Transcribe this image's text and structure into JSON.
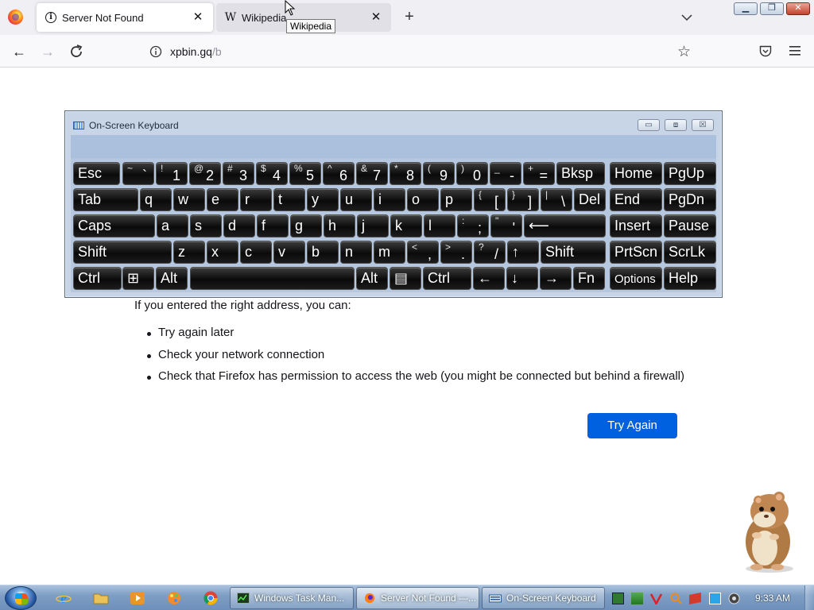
{
  "browser": {
    "tabs": [
      {
        "title": "Server Not Found",
        "active": true
      },
      {
        "title": "Wikipedia",
        "active": false
      }
    ],
    "tooltip": "Wikipedia",
    "url": {
      "host": "xpbin.gq",
      "path": "/b"
    }
  },
  "page": {
    "heading": "If you entered the right address, you can:",
    "suggestions": [
      "Try again later",
      "Check your network connection",
      "Check that Firefox has permission to access the web (you might be connected but behind a firewall)"
    ],
    "try_again_label": "Try Again"
  },
  "osk": {
    "title": "On-Screen Keyboard",
    "rows": [
      [
        {
          "type": "n",
          "label": "Esc"
        },
        {
          "type": "d",
          "top": "~",
          "bot": "`"
        },
        {
          "type": "d",
          "top": "!",
          "bot": "1"
        },
        {
          "type": "d",
          "top": "@",
          "bot": "2"
        },
        {
          "type": "d",
          "top": "#",
          "bot": "3"
        },
        {
          "type": "d",
          "top": "$",
          "bot": "4"
        },
        {
          "type": "d",
          "top": "%",
          "bot": "5"
        },
        {
          "type": "d",
          "top": "^",
          "bot": "6"
        },
        {
          "type": "d",
          "top": "&",
          "bot": "7"
        },
        {
          "type": "d",
          "top": "*",
          "bot": "8"
        },
        {
          "type": "d",
          "top": "(",
          "bot": "9"
        },
        {
          "type": "d",
          "top": ")",
          "bot": "0"
        },
        {
          "type": "d",
          "top": "_",
          "bot": "-"
        },
        {
          "type": "d",
          "top": "+",
          "bot": "="
        },
        {
          "type": "n",
          "label": "Bksp"
        },
        {
          "type": "n",
          "label": "Home"
        },
        {
          "type": "n",
          "label": "PgUp"
        }
      ],
      [
        {
          "type": "n",
          "label": "Tab"
        },
        {
          "type": "n",
          "label": "q"
        },
        {
          "type": "n",
          "label": "w"
        },
        {
          "type": "n",
          "label": "e"
        },
        {
          "type": "n",
          "label": "r"
        },
        {
          "type": "n",
          "label": "t"
        },
        {
          "type": "n",
          "label": "y"
        },
        {
          "type": "n",
          "label": "u"
        },
        {
          "type": "n",
          "label": "i"
        },
        {
          "type": "n",
          "label": "o"
        },
        {
          "type": "n",
          "label": "p"
        },
        {
          "type": "d",
          "top": "{",
          "bot": "["
        },
        {
          "type": "d",
          "top": "}",
          "bot": "]"
        },
        {
          "type": "d",
          "top": "|",
          "bot": "\\"
        },
        {
          "type": "n",
          "label": "Del"
        },
        {
          "type": "n",
          "label": "End"
        },
        {
          "type": "n",
          "label": "PgDn"
        }
      ],
      [
        {
          "type": "n",
          "label": "Caps"
        },
        {
          "type": "n",
          "label": "a"
        },
        {
          "type": "n",
          "label": "s"
        },
        {
          "type": "n",
          "label": "d"
        },
        {
          "type": "n",
          "label": "f"
        },
        {
          "type": "n",
          "label": "g"
        },
        {
          "type": "n",
          "label": "h"
        },
        {
          "type": "n",
          "label": "j"
        },
        {
          "type": "n",
          "label": "k"
        },
        {
          "type": "n",
          "label": "l"
        },
        {
          "type": "d",
          "top": ":",
          "bot": ";"
        },
        {
          "type": "d",
          "top": "\"",
          "bot": "'"
        },
        {
          "type": "n",
          "label": "⟵"
        },
        {
          "type": "n",
          "label": "Insert"
        },
        {
          "type": "n",
          "label": "Pause"
        }
      ],
      [
        {
          "type": "n",
          "label": "Shift"
        },
        {
          "type": "n",
          "label": "z"
        },
        {
          "type": "n",
          "label": "x"
        },
        {
          "type": "n",
          "label": "c"
        },
        {
          "type": "n",
          "label": "v"
        },
        {
          "type": "n",
          "label": "b"
        },
        {
          "type": "n",
          "label": "n"
        },
        {
          "type": "n",
          "label": "m"
        },
        {
          "type": "d",
          "top": "<",
          "bot": ","
        },
        {
          "type": "d",
          "top": ">",
          "bot": "."
        },
        {
          "type": "d",
          "top": "?",
          "bot": "/"
        },
        {
          "type": "n",
          "label": "↑"
        },
        {
          "type": "n",
          "label": "Shift"
        },
        {
          "type": "n",
          "label": "PrtScn"
        },
        {
          "type": "n",
          "label": "ScrLk"
        }
      ],
      [
        {
          "type": "n",
          "label": "Ctrl"
        },
        {
          "type": "n",
          "label": "⊞"
        },
        {
          "type": "n",
          "label": "Alt"
        },
        {
          "type": "n",
          "label": ""
        },
        {
          "type": "n",
          "label": "Alt"
        },
        {
          "type": "n",
          "label": "▤"
        },
        {
          "type": "n",
          "label": "Ctrl"
        },
        {
          "type": "n",
          "label": "←"
        },
        {
          "type": "n",
          "label": "↓"
        },
        {
          "type": "n",
          "label": "→"
        },
        {
          "type": "n",
          "label": "Fn"
        },
        {
          "type": "n",
          "label": "Options"
        },
        {
          "type": "n",
          "label": "Help"
        }
      ]
    ]
  },
  "taskbar": {
    "tasks": [
      {
        "label": "Windows Task Man...",
        "active": false
      },
      {
        "label": "Server Not Found —...",
        "active": true
      },
      {
        "label": "On-Screen Keyboard",
        "active": false
      }
    ],
    "clock": "9:33 AM"
  },
  "colors": {
    "accent": "#0061e0",
    "key_face": "#111111",
    "osk_frame": "#c7d5e7",
    "taskbar": "#7f9ec4"
  }
}
